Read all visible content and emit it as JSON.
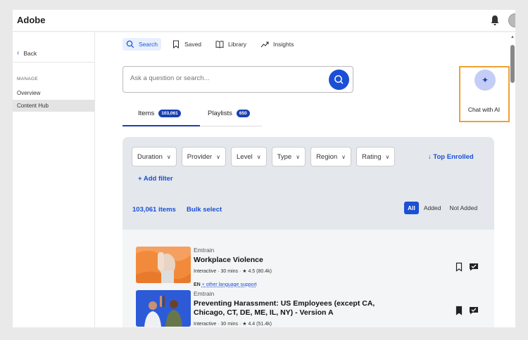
{
  "app": {
    "logo": "Adobe"
  },
  "sidebar": {
    "back_label": "Back",
    "section_label": "MANAGE",
    "items": [
      {
        "label": "Overview"
      },
      {
        "label": "Content Hub"
      }
    ]
  },
  "top_tabs": [
    {
      "label": "Search",
      "icon": "search-icon"
    },
    {
      "label": "Saved",
      "icon": "bookmark-icon"
    },
    {
      "label": "Library",
      "icon": "book-icon"
    },
    {
      "label": "Insights",
      "icon": "trend-icon"
    }
  ],
  "search": {
    "placeholder": "Ask a question or search..."
  },
  "chat_ai": {
    "label": "Chat with AI"
  },
  "content_tabs": [
    {
      "label": "Items",
      "count": "103,061"
    },
    {
      "label": "Playlists",
      "count": "650"
    }
  ],
  "filters": [
    "Duration",
    "Provider",
    "Level",
    "Type",
    "Region",
    "Rating"
  ],
  "sort_label": "Top Enrolled",
  "add_filter_label": "Add filter",
  "results_summary": {
    "count": "103,061 items",
    "bulk_select": "Bulk select"
  },
  "segment": [
    "All",
    "Added",
    "Not Added"
  ],
  "results": [
    {
      "provider": "Emtrain",
      "title": "Workplace Violence",
      "meta": "Interactive · 30 mins · ★ 4.5 (80.4k)",
      "lang_code": "EN",
      "lang_link": "+ other language support"
    },
    {
      "provider": "Emtrain",
      "title": "Preventing Harassment: US Employees (except CA, Chicago, CT, DE, ME, IL, NY) - Version A",
      "meta": "Interactive · 30 mins · ★ 4.4 (51.4k)"
    }
  ],
  "colors": {
    "accent": "#1a4fd6",
    "highlight_border": "#f0a030",
    "badge": "#1a3fb0"
  }
}
